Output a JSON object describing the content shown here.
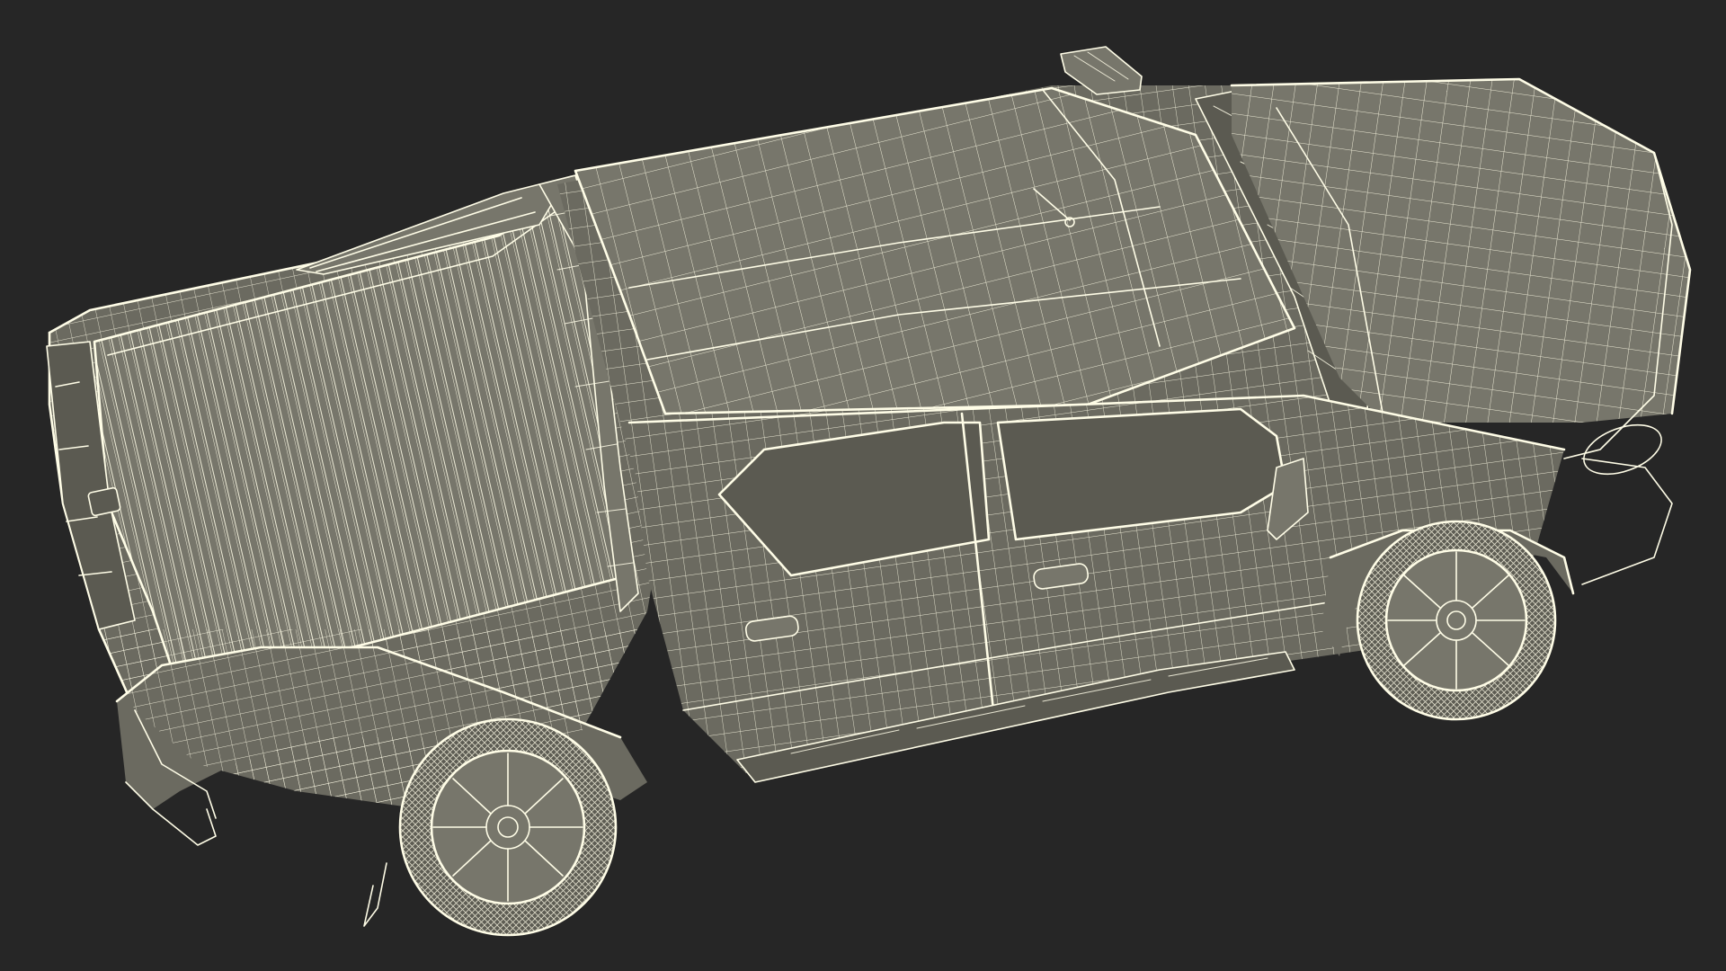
{
  "scene": {
    "subject_icon": "pickup-truck-wireframe-icon",
    "colors": {
      "background": "#262626",
      "surface": "#6b6a60",
      "wire": "#fffde7"
    }
  }
}
